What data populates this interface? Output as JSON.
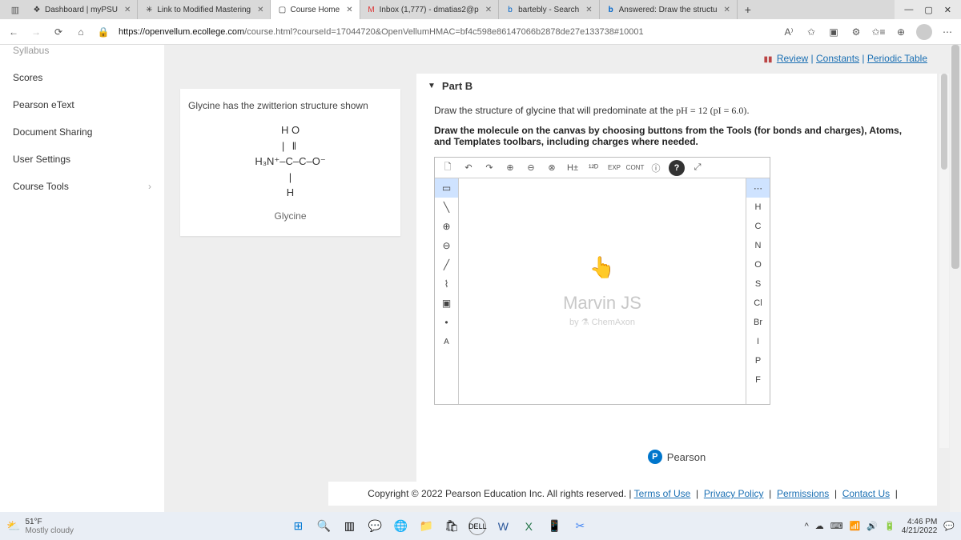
{
  "browser": {
    "tabs": [
      {
        "label": "Dashboard | myPSU",
        "icon": "❖"
      },
      {
        "label": "Link to Modified Mastering",
        "icon": "✳"
      },
      {
        "label": "Course Home",
        "icon": "▢",
        "active": true
      },
      {
        "label": "Inbox (1,777) - dmatias2@p",
        "icon": "M"
      },
      {
        "label": "bartebly - Search",
        "icon": "b"
      },
      {
        "label": "Answered: Draw the structu",
        "icon": "b"
      }
    ],
    "url_host": "https://openvellum.ecollege.com",
    "url_path": "/course.html?courseId=17044720&OpenVellumHMAC=bf4c598e86147066b2878de27e133738#10001"
  },
  "sidebar": {
    "items": [
      {
        "label": "Syllabus"
      },
      {
        "label": "Scores"
      },
      {
        "label": "Pearson eText"
      },
      {
        "label": "Document Sharing"
      },
      {
        "label": "User Settings"
      },
      {
        "label": "Course Tools"
      }
    ]
  },
  "toplinks": {
    "review": "Review",
    "constants": "Constants",
    "periodic": "Periodic Table"
  },
  "leftcard": {
    "lead": "Glycine has the zwitterion structure shown",
    "line1": "H   O",
    "line2": "|    ‖",
    "line3": "H₃N⁺–C–C–O⁻",
    "line4": "|",
    "line5": "H",
    "name": "Glycine"
  },
  "partb": {
    "title": "Part B",
    "q1_a": "Draw the structure of glycine that will predominate at the ",
    "q1_b": "pH = 12 (pI = 6.0)",
    "q1_c": ".",
    "q2": "Draw the molecule on the canvas by choosing buttons from the Tools (for bonds and charges), Atoms, and Templates toolbars, including charges where needed."
  },
  "editor": {
    "top": [
      "🗋",
      "↶",
      "↷",
      "⊕",
      "⊖",
      "⊗",
      "H±",
      "¹²ᴰ",
      "EXP",
      "CONT",
      "ⓘ",
      "?",
      "⤢"
    ],
    "left": [
      "▭",
      "╲",
      "⊕",
      "⊖",
      "╱",
      "⌇",
      "▣",
      "•",
      "A"
    ],
    "right": [
      "⋯",
      "H",
      "C",
      "N",
      "O",
      "S",
      "Cl",
      "Br",
      "I",
      "P",
      "F"
    ],
    "brand": "Marvin JS",
    "by": "by ⚗ ChemAxon"
  },
  "footer": {
    "pearson": "Pearson",
    "copy": "Copyright © 2022 Pearson Education Inc. All rights reserved. | ",
    "links": [
      "Terms of Use",
      "Privacy Policy",
      "Permissions",
      "Contact Us"
    ]
  },
  "taskbar": {
    "temp": "51°F",
    "cond": "Mostly cloudy",
    "time": "4:46 PM",
    "date": "4/21/2022"
  }
}
